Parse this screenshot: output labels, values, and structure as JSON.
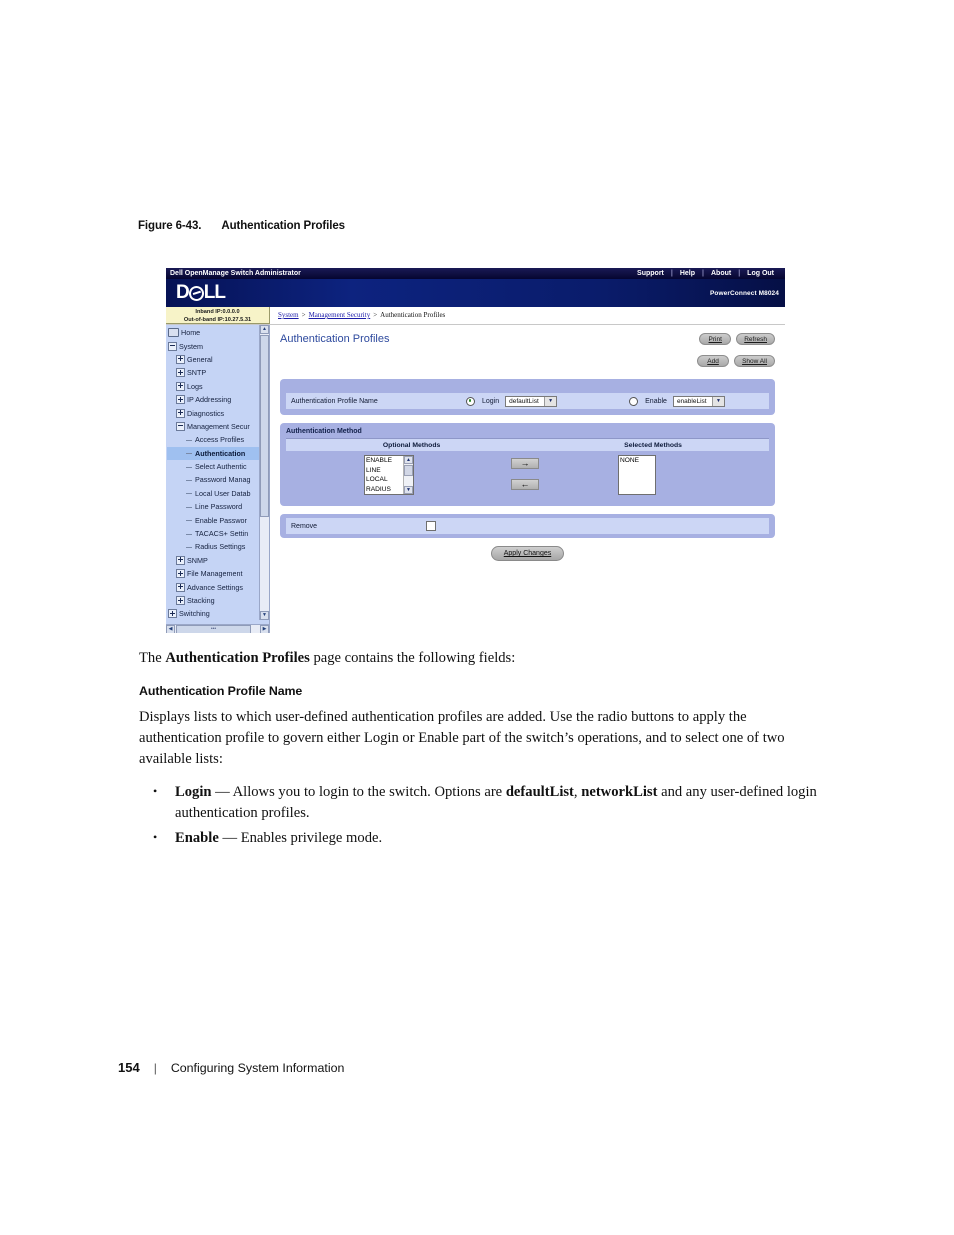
{
  "figure": {
    "number": "Figure 6-43.",
    "title": "Authentication Profiles"
  },
  "screenshot": {
    "topbar": {
      "app_title": "Dell OpenManage Switch Administrator",
      "nav": [
        "Support",
        "Help",
        "About",
        "Log Out"
      ],
      "separator": "|"
    },
    "brand": {
      "logo_text_left": "D",
      "logo_text_right": "LL",
      "product": "PowerConnect M8024"
    },
    "ip_box": {
      "inband": "Inband IP:0.0.0.0",
      "out_of_band": "Out-of-band IP:10.27.5.31"
    },
    "breadcrumb": {
      "items": [
        "System",
        "Management Security",
        "Authentication Profiles"
      ],
      "arrow": ">"
    },
    "sidebar": {
      "items": [
        {
          "label": "Home",
          "level": 1,
          "marker": "home",
          "selected": false
        },
        {
          "label": "System",
          "level": 1,
          "marker": "minus",
          "selected": false
        },
        {
          "label": "General",
          "level": 2,
          "marker": "plus",
          "selected": false
        },
        {
          "label": "SNTP",
          "level": 2,
          "marker": "plus",
          "selected": false
        },
        {
          "label": "Logs",
          "level": 2,
          "marker": "plus",
          "selected": false
        },
        {
          "label": "IP Addressing",
          "level": 2,
          "marker": "plus",
          "selected": false
        },
        {
          "label": "Diagnostics",
          "level": 2,
          "marker": "plus",
          "selected": false
        },
        {
          "label": "Management Secur",
          "level": 2,
          "marker": "minus",
          "selected": false
        },
        {
          "label": "Access Profiles",
          "level": 3,
          "marker": "dash",
          "selected": false
        },
        {
          "label": "Authentication",
          "level": 3,
          "marker": "dash",
          "selected": true
        },
        {
          "label": "Select Authentic",
          "level": 3,
          "marker": "dash",
          "selected": false
        },
        {
          "label": "Password Manag",
          "level": 3,
          "marker": "dash",
          "selected": false
        },
        {
          "label": "Local User Datab",
          "level": 3,
          "marker": "dash",
          "selected": false
        },
        {
          "label": "Line Password",
          "level": 3,
          "marker": "dash",
          "selected": false
        },
        {
          "label": "Enable Passwor",
          "level": 3,
          "marker": "dash",
          "selected": false
        },
        {
          "label": "TACACS+ Settin",
          "level": 3,
          "marker": "dash",
          "selected": false
        },
        {
          "label": "Radius Settings",
          "level": 3,
          "marker": "dash",
          "selected": false
        },
        {
          "label": "SNMP",
          "level": 2,
          "marker": "plus",
          "selected": false
        },
        {
          "label": "File Management",
          "level": 2,
          "marker": "plus",
          "selected": false
        },
        {
          "label": "Advance Settings",
          "level": 2,
          "marker": "plus",
          "selected": false
        },
        {
          "label": "Stacking",
          "level": 2,
          "marker": "plus",
          "selected": false
        },
        {
          "label": "Switching",
          "level": 1,
          "marker": "plus",
          "selected": false
        }
      ],
      "scroll_up": "▲",
      "scroll_down": "▼",
      "scroll_left": "◀",
      "scroll_right": "▶",
      "h_thumb_label": "•••"
    },
    "content": {
      "page_title": "Authentication Profiles",
      "buttons_row1": [
        "Print",
        "Refresh"
      ],
      "buttons_row2": [
        "Add",
        "Show All"
      ],
      "profile_panel": {
        "field_label": "Authentication Profile Name",
        "login_radio": {
          "label": "Login",
          "selected": true
        },
        "login_select": {
          "value": "defaultList",
          "caret": "▼"
        },
        "enable_radio": {
          "label": "Enable",
          "selected": false
        },
        "enable_select": {
          "value": "enableList",
          "caret": "▼"
        }
      },
      "method_panel": {
        "title": "Authentication Method",
        "col_optional": "Optional Methods",
        "col_selected": "Selected Methods",
        "optional_methods": [
          "ENABLE",
          "LINE",
          "LOCAL",
          "RADIUS"
        ],
        "selected_methods": [
          "NONE"
        ],
        "add_arrow": "→",
        "remove_arrow": "←",
        "list_scroll_up": "▲",
        "list_scroll_down": "▼"
      },
      "remove_panel": {
        "label": "Remove",
        "checked": false
      },
      "apply_button": "Apply Changes"
    }
  },
  "prose": {
    "intro_before": "The ",
    "intro_bold": "Authentication Profiles",
    "intro_after": " page contains the following fields:",
    "sub_head": "Authentication Profile Name",
    "description": "Displays lists to which user-defined authentication profiles are added. Use the radio buttons to apply the authentication profile to govern either Login or Enable part of the switch’s operations, and to select one of two available lists:",
    "bullets": [
      {
        "term": "Login",
        "dash": " — ",
        "text_a": "Allows you to login to the switch. Options are ",
        "bold_a": "defaultList",
        "comma": ", ",
        "bold_b": "networkList",
        "text_b": " and any user-defined login authentication profiles."
      },
      {
        "term": "Enable",
        "dash": " — ",
        "text_a": "Enables privilege mode.",
        "bold_a": "",
        "comma": "",
        "bold_b": "",
        "text_b": ""
      }
    ]
  },
  "footer": {
    "page_number": "154",
    "divider": "|",
    "section": "Configuring System Information"
  },
  "colors": {
    "dell_blue": "#0a1b6b",
    "panel_lavender": "#a7b0e2",
    "panel_row_light": "#ccd6f5",
    "sidebar_blue": "#c5d4f5",
    "selected_item": "#9fc0f0",
    "title_blue": "#2e4a9e",
    "ip_box_yellow": "#f7f3c8",
    "link_blue": "#1a1aa8"
  }
}
